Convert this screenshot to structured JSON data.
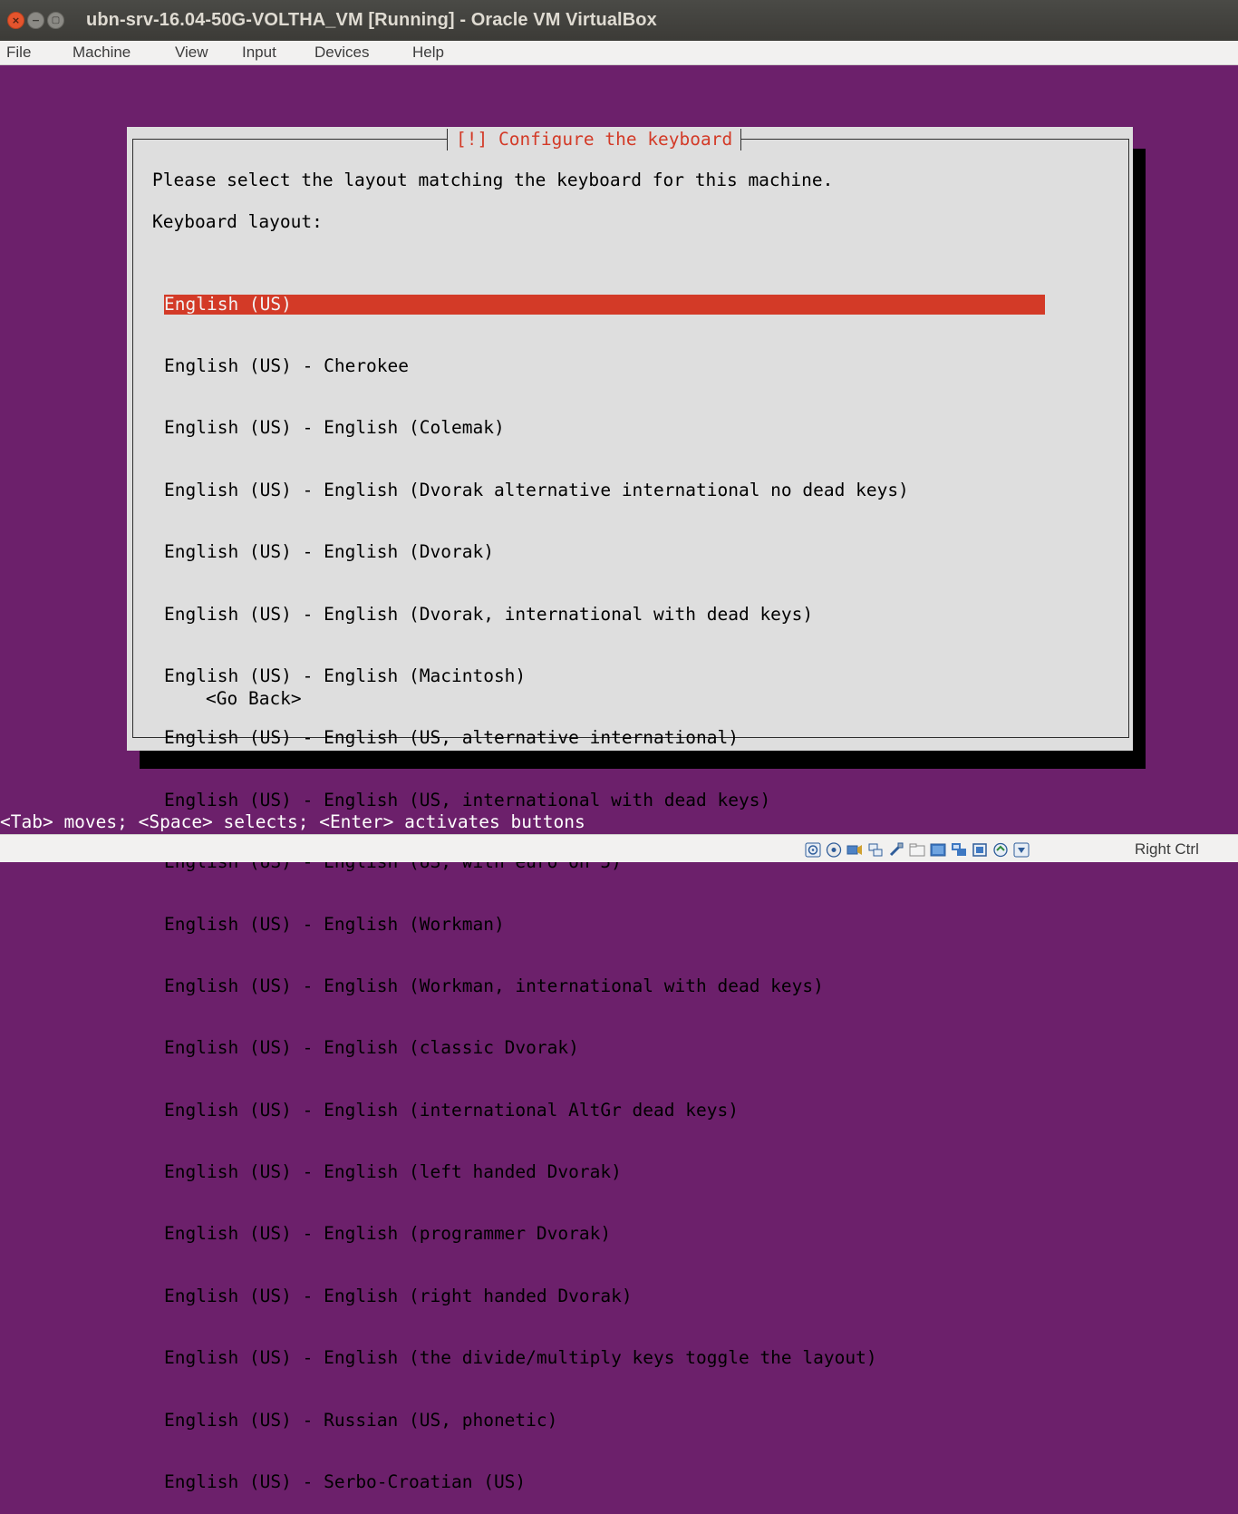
{
  "window": {
    "title": "ubn-srv-16.04-50G-VOLTHA_VM [Running] - Oracle VM VirtualBox",
    "close_glyph": "×",
    "minimize_glyph": "−",
    "maximize_glyph": "▢"
  },
  "menubar": {
    "items": [
      "File",
      "Machine",
      "View",
      "Input",
      "Devices",
      "Help"
    ]
  },
  "dialog": {
    "title": "[!] Configure the keyboard",
    "prompt": "Please select the layout matching the keyboard for this machine.",
    "list_label": "Keyboard layout:",
    "selected_index": 0,
    "options": [
      "English (US)",
      "English (US) - Cherokee",
      "English (US) - English (Colemak)",
      "English (US) - English (Dvorak alternative international no dead keys)",
      "English (US) - English (Dvorak)",
      "English (US) - English (Dvorak, international with dead keys)",
      "English (US) - English (Macintosh)",
      "English (US) - English (US, alternative international)",
      "English (US) - English (US, international with dead keys)",
      "English (US) - English (US, with euro on 5)",
      "English (US) - English (Workman)",
      "English (US) - English (Workman, international with dead keys)",
      "English (US) - English (classic Dvorak)",
      "English (US) - English (international AltGr dead keys)",
      "English (US) - English (left handed Dvorak)",
      "English (US) - English (programmer Dvorak)",
      "English (US) - English (right handed Dvorak)",
      "English (US) - English (the divide/multiply keys toggle the layout)",
      "English (US) - Russian (US, phonetic)",
      "English (US) - Serbo-Croatian (US)"
    ],
    "go_back": "<Go Back>"
  },
  "helpline": "<Tab> moves; <Space> selects; <Enter> activates buttons",
  "statusbar": {
    "icons": [
      "hard-disk-icon",
      "optical-drive-icon",
      "audio-icon",
      "network-icon",
      "usb-icon",
      "shared-folders-icon",
      "display-icon",
      "video-capture-icon",
      "cpu-icon",
      "mouse-integration-icon",
      "keyboard-capture-icon"
    ],
    "host_key": "Right Ctrl"
  },
  "colors": {
    "vm_background": "#6c206b",
    "dialog_background": "#dedede",
    "dialog_title": "#d33a27",
    "selection": "#d33a27"
  }
}
